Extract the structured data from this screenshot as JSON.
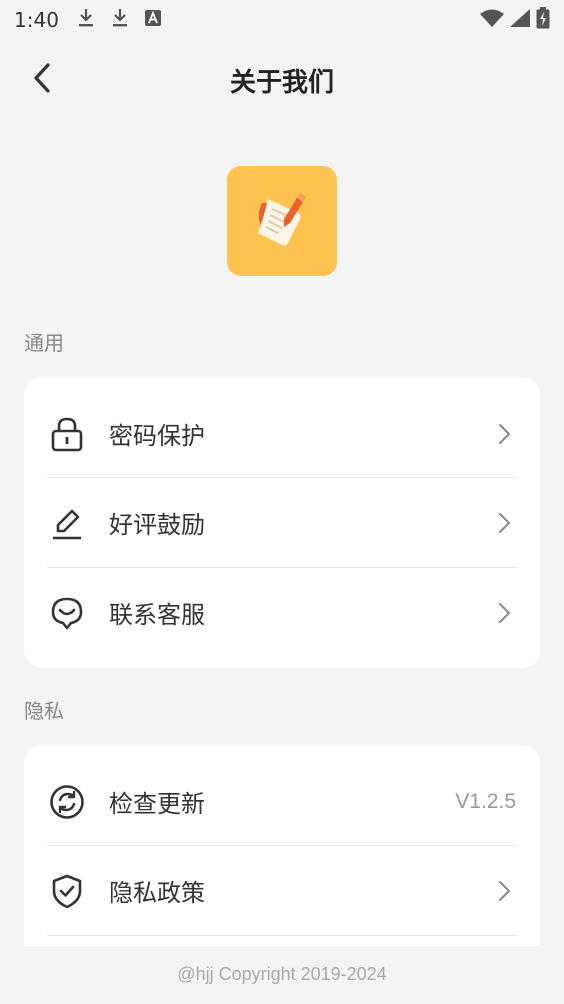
{
  "status_bar": {
    "time": "1:40",
    "left_icons": [
      "download-icon",
      "download-icon",
      "font-a-icon"
    ],
    "right_icons": [
      "wifi-icon",
      "signal-icon",
      "battery-icon"
    ]
  },
  "header": {
    "title": "关于我们",
    "back_icon": "chevron-left-icon"
  },
  "app": {
    "logo_icon": "notepad-pen-icon",
    "logo_color": "#fec24e"
  },
  "sections": {
    "general": {
      "title": "通用",
      "items": [
        {
          "label": "密码保护",
          "icon": "lock-icon"
        },
        {
          "label": "好评鼓励",
          "icon": "pencil-icon"
        },
        {
          "label": "联系客服",
          "icon": "smile-chat-icon"
        }
      ]
    },
    "privacy": {
      "title": "隐私",
      "items": [
        {
          "label": "检查更新",
          "icon": "refresh-icon",
          "value": "V1.2.5"
        },
        {
          "label": "隐私政策",
          "icon": "shield-check-icon"
        }
      ]
    }
  },
  "footer": {
    "copyright": "@hjj Copyright 2019-2024"
  }
}
